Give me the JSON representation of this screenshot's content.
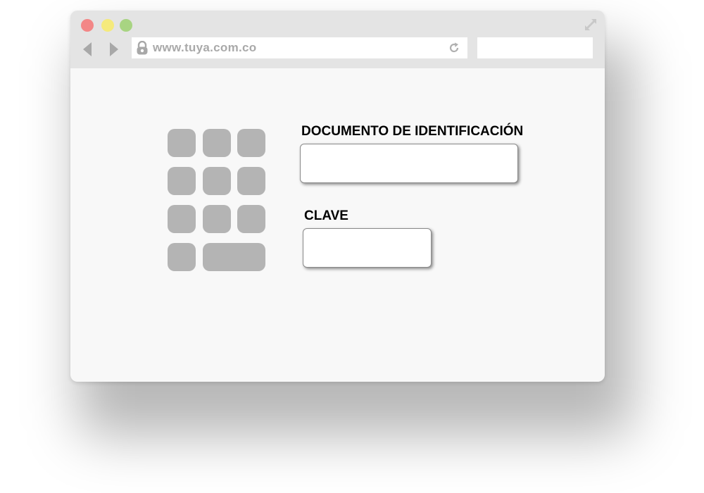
{
  "browser": {
    "url": "www.tuya.com.co",
    "traffic_lights": {
      "close_color": "#f38787",
      "minimize_color": "#f5ea7c",
      "maximize_color": "#a8d482"
    },
    "chrome_color": "#e4e4e4",
    "icons": [
      "arrow-left-icon",
      "arrow-right-icon",
      "lock-icon",
      "reload-icon",
      "expand-icon"
    ]
  },
  "login": {
    "document_label": "DOCUMENTO DE IDENTIFICACIÓN",
    "document_value": "",
    "password_label": "CLAVE",
    "password_value": ""
  },
  "keypad": {
    "key_color": "#b4b4b4",
    "keys": [
      "",
      "",
      "",
      "",
      "",
      "",
      "",
      "",
      "",
      "",
      ""
    ]
  }
}
